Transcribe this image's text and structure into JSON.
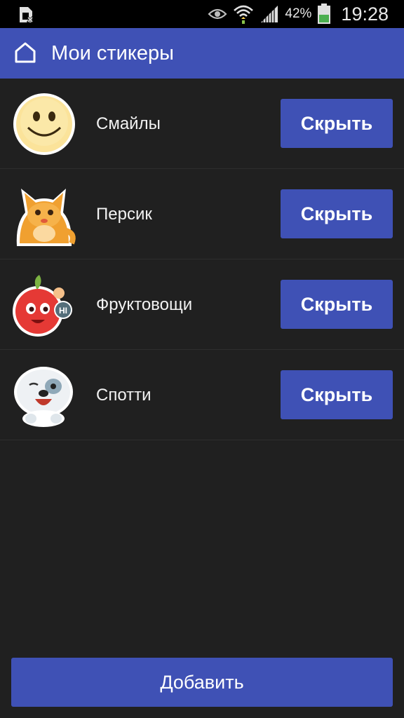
{
  "status_bar": {
    "battery_percent": "42%",
    "time": "19:28",
    "icons": [
      "sim-icon",
      "eye-icon",
      "wifi-icon",
      "signal-icon",
      "battery-icon"
    ],
    "battery_color": "#4caf50"
  },
  "app_bar": {
    "title": "Мои стикеры",
    "icon": "home-icon",
    "color": "#3f51b5"
  },
  "stickers": [
    {
      "name": "Смайлы",
      "button": "Скрыть",
      "icon": "smiley-sticker"
    },
    {
      "name": "Персик",
      "button": "Скрыть",
      "icon": "cat-sticker"
    },
    {
      "name": "Фруктовощи",
      "button": "Скрыть",
      "icon": "apple-sticker"
    },
    {
      "name": "Спотти",
      "button": "Скрыть",
      "icon": "dog-sticker"
    }
  ],
  "footer": {
    "add_label": "Добавить"
  }
}
